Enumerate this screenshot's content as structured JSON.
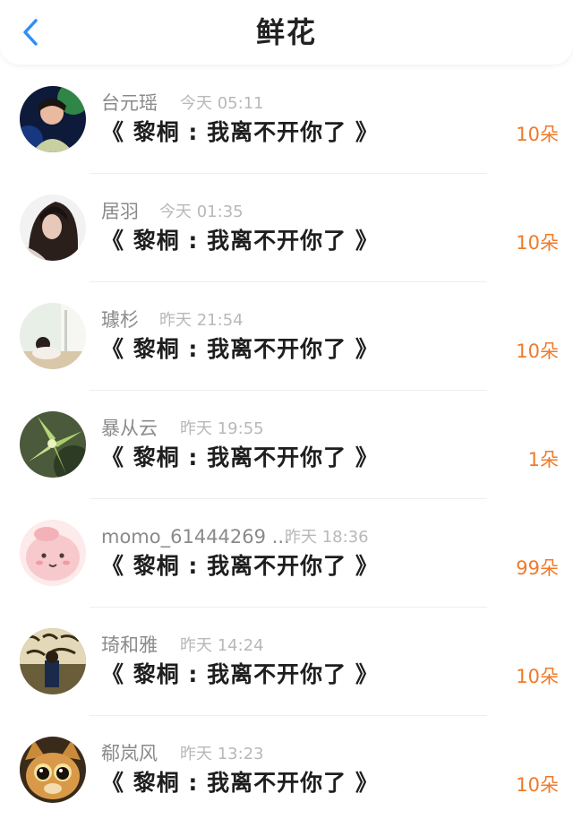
{
  "header": {
    "title": "鲜花",
    "back_icon": "chevron-left-icon"
  },
  "colors": {
    "accent_blue": "#2f8ff5",
    "flower_count": "#f07a2a",
    "name_gray": "#8a8a8a",
    "time_gray": "#b8b8b8"
  },
  "rows": [
    {
      "name": "台元瑶",
      "time": "今天 05:11",
      "message": "《 黎桐 : 我离不开你了 》",
      "count": "10朵"
    },
    {
      "name": "居羽",
      "time": "今天 01:35",
      "message": "《 黎桐 : 我离不开你了 》",
      "count": "10朵"
    },
    {
      "name": "璩杉",
      "time": "昨天 21:54",
      "message": "《 黎桐 : 我离不开你了 》",
      "count": "10朵"
    },
    {
      "name": "暴从云",
      "time": "昨天 19:55",
      "message": "《 黎桐 : 我离不开你了 》",
      "count": "1朵"
    },
    {
      "name": "momo_61444269 ...",
      "time": "昨天 18:36",
      "message": "《 黎桐 : 我离不开你了 》",
      "count": "99朵"
    },
    {
      "name": "琦和雅",
      "time": "昨天 14:24",
      "message": "《 黎桐 : 我离不开你了 》",
      "count": "10朵"
    },
    {
      "name": "郗岚风",
      "time": "昨天 13:23",
      "message": "《 黎桐 : 我离不开你了 》",
      "count": "10朵"
    }
  ]
}
